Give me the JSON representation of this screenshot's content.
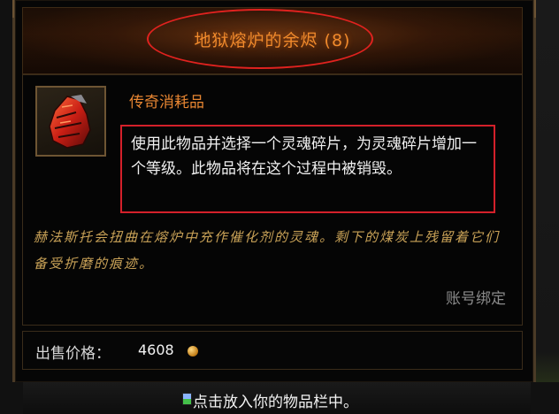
{
  "item": {
    "name": "地狱熔炉的余烬 (8)",
    "type": "传奇消耗品",
    "description": "使用此物品并选择一个灵魂碎片，为灵魂碎片增加一个等级。此物品将在这个过程中被销毁。",
    "flavor": "赫法斯托会扭曲在熔炉中充作催化剂的灵魂。剩下的煤炭上残留着它们备受折磨的痕迹。",
    "binding": "账号绑定",
    "icon": "ember-icon"
  },
  "price": {
    "label": "出售价格：",
    "value": "4608",
    "currency_icon": "gold-coin-icon"
  },
  "hint": {
    "text": "点击放入你的物品栏中。",
    "icon": "mouse-icon"
  },
  "colors": {
    "title": "#f08a2c",
    "annotation_red": "#d4202a",
    "flavor": "#c9a257"
  }
}
